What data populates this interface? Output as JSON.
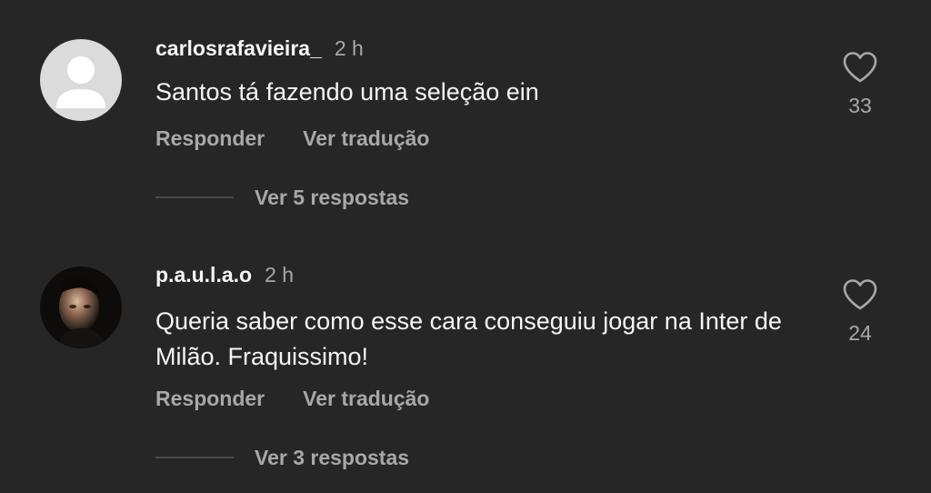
{
  "comments": [
    {
      "username": "carlosrafavieira_",
      "time": "2 h",
      "text": "Santos tá fazendo uma seleção ein",
      "reply_label": "Responder",
      "translate_label": "Ver tradução",
      "likes": "33",
      "view_replies_label": "Ver 5 respostas",
      "avatar_type": "default-avatar-icon"
    },
    {
      "username": "p.a.u.l.a.o",
      "time": "2 h",
      "text": "Queria saber como esse cara conseguiu jogar na Inter de Milão. Fraquissimo!",
      "reply_label": "Responder",
      "translate_label": "Ver tradução",
      "likes": "24",
      "view_replies_label": "Ver 3 respostas",
      "avatar_type": "profile-photo"
    }
  ],
  "colors": {
    "background": "#262626",
    "primary_text": "#f5f5f5",
    "secondary_text": "#a8a8a8"
  }
}
